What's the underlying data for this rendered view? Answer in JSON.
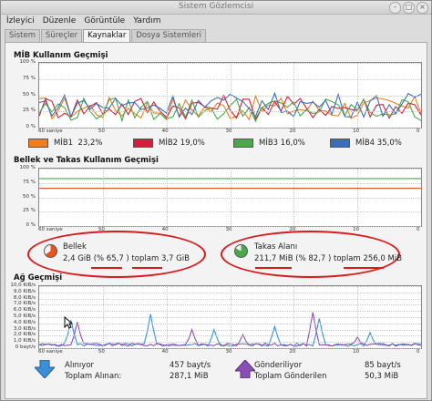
{
  "window": {
    "title": "Sistem Gözlemcisi",
    "buttons": [
      "–",
      "□",
      "×"
    ]
  },
  "menu": [
    "İzleyici",
    "Düzenle",
    "Görüntüle",
    "Yardım"
  ],
  "tabs": [
    "Sistem",
    "Süreçler",
    "Kaynaklar",
    "Dosya Sistemleri"
  ],
  "active_tab": "Kaynaklar",
  "cpu": {
    "title": "MİB Kullanım Geçmişi",
    "y_ticks": [
      "100 %",
      "75 %",
      "50 %",
      "25 %",
      "0 %"
    ],
    "x_ticks": [
      "60 saniye",
      "50",
      "40",
      "30",
      "20",
      "10",
      "0"
    ],
    "legend": [
      {
        "name": "MİB1",
        "value": "23,2%",
        "color": "#f07d1e"
      },
      {
        "name": "MİB2",
        "value": "19,0%",
        "color": "#d0203a"
      },
      {
        "name": "MİB3",
        "value": "16,0%",
        "color": "#4aa84a"
      },
      {
        "name": "MİB4",
        "value": "35,0%",
        "color": "#3b6fb5"
      }
    ]
  },
  "memory": {
    "title": "Bellek ve Takas Kullanım Geçmişi",
    "y_ticks": [
      "100 %",
      "75 %",
      "50 %",
      "25 %",
      "0 %"
    ],
    "x_ticks": [
      "60 saniye",
      "50",
      "40",
      "30",
      "20",
      "10",
      "0"
    ],
    "ram_label": "Bellek",
    "ram_used": "2,4 GiB",
    "ram_percent": "(% 65,7 )",
    "ram_total_label": "toplam",
    "ram_total": "3,7 GiB",
    "swap_label": "Takas Alanı",
    "swap_used": "211,7 MiB",
    "swap_percent": "(% 82,7 )",
    "swap_total_label": "toplam",
    "swap_total": "256,0 MiB",
    "ram_fraction": 0.657,
    "swap_fraction": 0.827,
    "ram_color": "#e8541c",
    "swap_color": "#4aa84a"
  },
  "network": {
    "title": "Ağ Geçmişi",
    "y_ticks": [
      "10,0 KiB/s",
      "9,0 KiB/s",
      "8,0 KiB/s",
      "7,0 KiB/s",
      "6,0 KiB/s",
      "5,0 KiB/s",
      "4,0 KiB/s",
      "3,0 KiB/s",
      "2,0 KiB/s",
      "1,0 KiB/s",
      "0 bayt/s"
    ],
    "x_ticks": [
      "60 saniye",
      "50",
      "40",
      "30",
      "20",
      "10",
      "0"
    ],
    "recv_label": "Alınıyor",
    "recv_rate": "457 bayt/s",
    "recv_total_label": "Toplam Alınan:",
    "recv_total": "287,1 MiB",
    "send_label": "Gönderiliyor",
    "send_rate": "85 bayt/s",
    "send_total_label": "Toplam Gönderilen",
    "send_total": "50,3 MiB",
    "recv_color": "#3b8fd8",
    "send_color": "#8a4fb5"
  }
}
